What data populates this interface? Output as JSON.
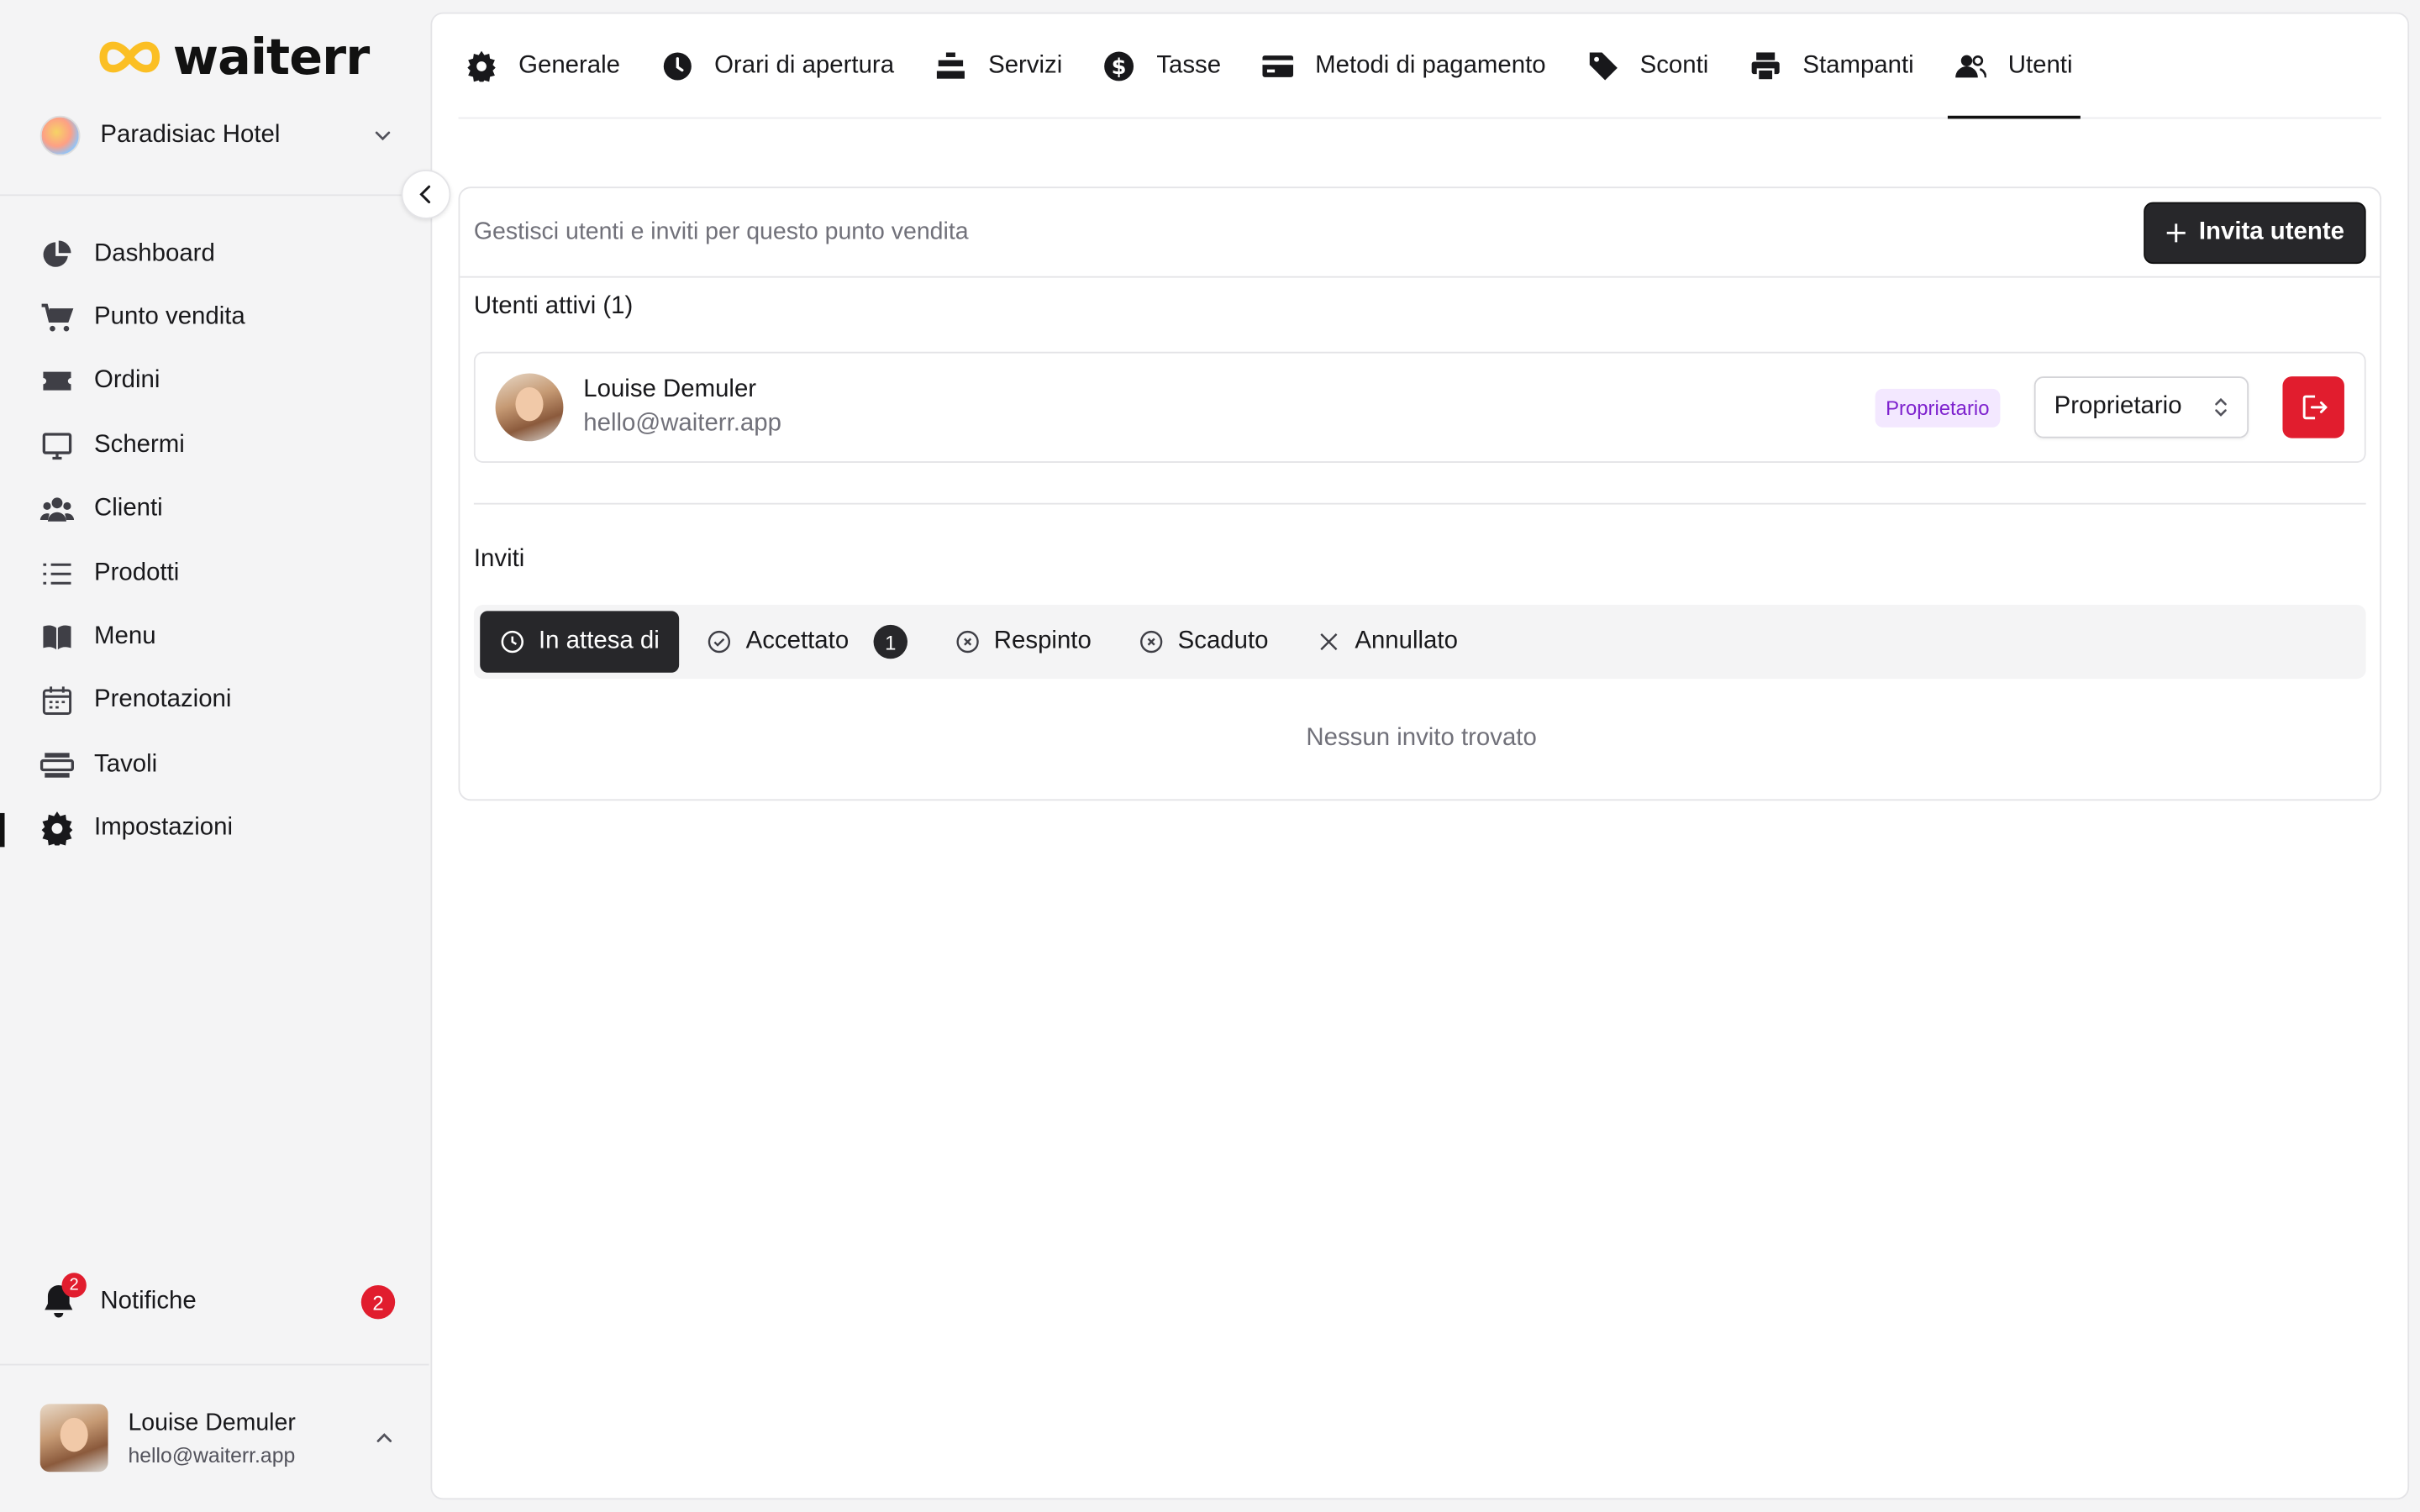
{
  "app": {
    "brand": "waiterr",
    "accent": "#fbbf24",
    "danger": "#e11d2e"
  },
  "sidebar": {
    "store_name": "Paradisiac Hotel",
    "items": [
      {
        "label": "Dashboard",
        "icon": "pie-chart-icon"
      },
      {
        "label": "Punto vendita",
        "icon": "cart-icon"
      },
      {
        "label": "Ordini",
        "icon": "ticket-icon"
      },
      {
        "label": "Schermi",
        "icon": "monitor-icon"
      },
      {
        "label": "Clienti",
        "icon": "users-icon"
      },
      {
        "label": "Prodotti",
        "icon": "list-icon"
      },
      {
        "label": "Menu",
        "icon": "book-icon"
      },
      {
        "label": "Prenotazioni",
        "icon": "calendar-icon"
      },
      {
        "label": "Tavoli",
        "icon": "table-icon"
      },
      {
        "label": "Impostazioni",
        "icon": "gear-icon",
        "active": true
      }
    ],
    "notifications": {
      "label": "Notifiche",
      "count": "2",
      "bell_badge": "2"
    },
    "profile": {
      "name": "Louise Demuler",
      "email": "hello@waiterr.app"
    }
  },
  "tabs": [
    {
      "label": "Generale",
      "icon": "gear-icon"
    },
    {
      "label": "Orari di apertura",
      "icon": "clock-icon"
    },
    {
      "label": "Servizi",
      "icon": "cloche-icon"
    },
    {
      "label": "Tasse",
      "icon": "dollar-icon"
    },
    {
      "label": "Metodi di pagamento",
      "icon": "credit-card-icon"
    },
    {
      "label": "Sconti",
      "icon": "tag-icon"
    },
    {
      "label": "Stampanti",
      "icon": "printer-icon"
    },
    {
      "label": "Utenti",
      "icon": "users-icon",
      "active": true
    }
  ],
  "users": {
    "description": "Gestisci utenti e inviti per questo punto vendita",
    "invite_button": "Invita utente",
    "active_title": "Utenti attivi (1)",
    "active_users": [
      {
        "name": "Louise Demuler",
        "email": "hello@waiterr.app",
        "badge": "Proprietario",
        "role": "Proprietario"
      }
    ],
    "invites_title": "Inviti",
    "filters": [
      {
        "label": "In attesa di",
        "icon": "clock-icon",
        "active": true
      },
      {
        "label": "Accettato",
        "icon": "check-circle-icon",
        "count": "1"
      },
      {
        "label": "Respinto",
        "icon": "x-circle-icon"
      },
      {
        "label": "Scaduto",
        "icon": "x-circle-icon"
      },
      {
        "label": "Annullato",
        "icon": "x-icon"
      }
    ],
    "empty_text": "Nessun invito trovato"
  }
}
